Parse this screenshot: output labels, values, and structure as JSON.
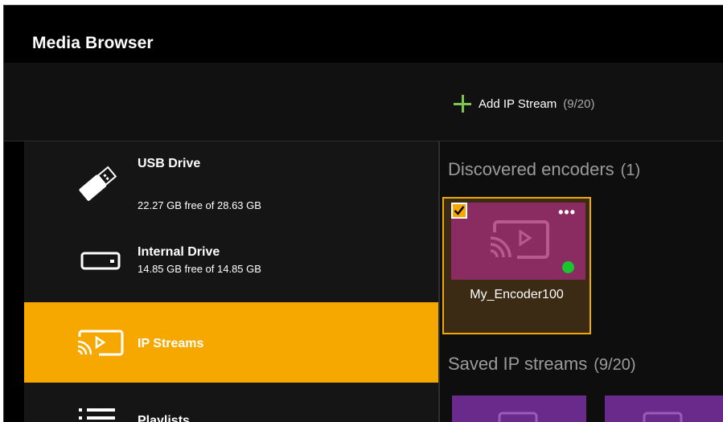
{
  "window": {
    "title": "Media Browser"
  },
  "toolbar": {
    "add_label": "Add IP Stream",
    "add_count": "(9/20)",
    "add_icon": "plus-icon",
    "accent": "#7cc54f"
  },
  "sidebar": {
    "active_color": "#f6a800",
    "items": [
      {
        "name": "USB Drive",
        "sub": "22.27 GB free of 28.63 GB",
        "icon": "usb-drive-icon"
      },
      {
        "name": "Internal Drive",
        "sub": "14.85 GB free of 14.85 GB",
        "icon": "internal-drive-icon"
      },
      {
        "name": "IP Streams",
        "icon": "ip-stream-icon",
        "active": true
      },
      {
        "name": "Playlists",
        "icon": "playlist-icon"
      }
    ]
  },
  "content": {
    "discovered": {
      "title": "Discovered encoders",
      "count": "(1)",
      "items": [
        {
          "name": "My_Encoder100",
          "checked": true,
          "online": true,
          "menu": "•••"
        }
      ]
    },
    "saved": {
      "title": "Saved IP streams",
      "count": "(9/20)"
    }
  }
}
